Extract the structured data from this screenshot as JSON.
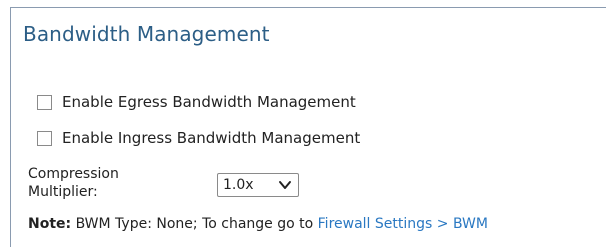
{
  "section": {
    "title": "Bandwidth Management"
  },
  "options": [
    {
      "label": "Enable Egress Bandwidth Management",
      "checked": false
    },
    {
      "label": "Enable Ingress Bandwidth Management",
      "checked": false
    }
  ],
  "compression": {
    "label_line1": "Compression",
    "label_line2": "Multiplier:",
    "selected": "1.0x"
  },
  "note": {
    "prefix": "Note:",
    "text": " BWM Type: None; To change go to ",
    "link": "Firewall Settings > BWM"
  },
  "colors": {
    "title": "#2c5e86",
    "link": "#2a78c2",
    "border": "#8a9bb0"
  },
  "icons": {
    "select_chevron": "chevron-down-icon",
    "checkbox": "checkbox-icon"
  }
}
